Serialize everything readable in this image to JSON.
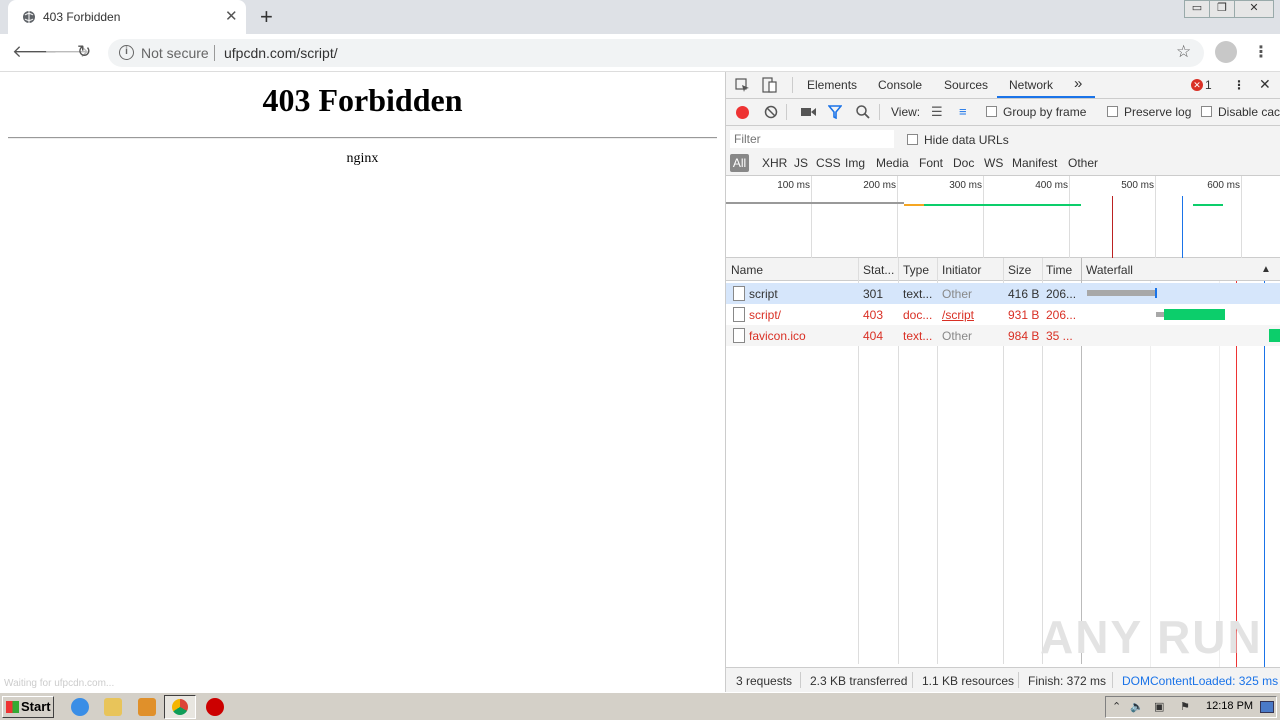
{
  "browser": {
    "tab_title": "403 Forbidden",
    "tab_close": "✕",
    "new_tab": "+",
    "not_secure": "Not secure",
    "url": "ufpcdn.com/script/",
    "window_controls": {
      "minimize": "▭",
      "restore": "❐",
      "close": "✕"
    }
  },
  "page": {
    "title": "403 Forbidden",
    "server": "nginx",
    "status_text": "Waiting for ufpcdn.com..."
  },
  "devtools": {
    "tabs": [
      "Elements",
      "Console",
      "Sources",
      "Network"
    ],
    "more_tabs": "»",
    "error_count": "1",
    "toolbar": {
      "view_label": "View:",
      "group_by_frame": "Group by frame",
      "preserve_log": "Preserve log",
      "disable_cache": "Disable cac"
    },
    "filter_placeholder": "Filter",
    "hide_data_urls": "Hide data URLs",
    "type_filters": [
      "All",
      "XHR",
      "JS",
      "CSS",
      "Img",
      "Media",
      "Font",
      "Doc",
      "WS",
      "Manifest",
      "Other"
    ],
    "overview_ticks": [
      "100 ms",
      "200 ms",
      "300 ms",
      "400 ms",
      "500 ms",
      "600 ms"
    ],
    "columns": [
      "Name",
      "Stat...",
      "Type",
      "Initiator",
      "Size",
      "Time",
      "Waterfall"
    ],
    "rows": [
      {
        "name": "script",
        "status": "301",
        "type": "text...",
        "initiator": "Other",
        "size": "416 B",
        "time": "206...",
        "error": false
      },
      {
        "name": "script/",
        "status": "403",
        "type": "doc...",
        "initiator": "/script",
        "size": "931 B",
        "time": "206...",
        "error": true
      },
      {
        "name": "favicon.ico",
        "status": "404",
        "type": "text...",
        "initiator": "Other",
        "size": "984 B",
        "time": "35 ...",
        "error": true
      }
    ],
    "status_bar": {
      "requests": "3 requests",
      "transferred": "2.3 KB transferred",
      "resources": "1.1 KB resources",
      "finish": "Finish: 372 ms",
      "dom_content_loaded": "DOMContentLoaded: 325 ms"
    }
  },
  "watermark": "ANY RUN",
  "taskbar": {
    "start": "Start",
    "clock": "12:18 PM"
  },
  "colors": {
    "accent": "#1a73e8",
    "error": "#d93025",
    "waterfall_green": "#0cce6b",
    "waterfall_gray": "#a8a8a8",
    "dcl_line": "#1a73e8",
    "load_line": "#e33"
  }
}
